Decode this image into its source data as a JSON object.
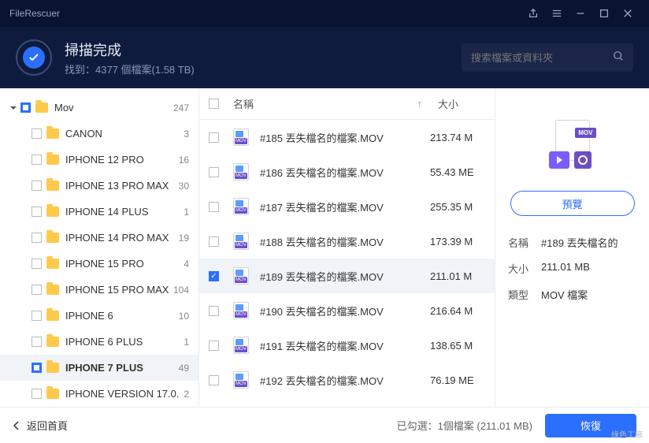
{
  "app_title": "FileRescuer",
  "header": {
    "title": "掃描完成",
    "subtitle": "找到：4377 個檔案(1.58 TB)"
  },
  "search": {
    "placeholder": "搜索檔案或資料夾"
  },
  "sidebar": {
    "root": {
      "label": "Mov",
      "count": "247"
    },
    "items": [
      {
        "label": "CANON",
        "count": "3",
        "partial": false
      },
      {
        "label": "IPHONE 12 PRO",
        "count": "16",
        "partial": false
      },
      {
        "label": "IPHONE 13 PRO MAX",
        "count": "30",
        "partial": false
      },
      {
        "label": "IPHONE 14 PLUS",
        "count": "1",
        "partial": false
      },
      {
        "label": "IPHONE 14 PRO MAX",
        "count": "19",
        "partial": false
      },
      {
        "label": "IPHONE 15 PRO",
        "count": "4",
        "partial": false
      },
      {
        "label": "IPHONE 15 PRO MAX",
        "count": "104",
        "partial": false
      },
      {
        "label": "IPHONE 6",
        "count": "10",
        "partial": false
      },
      {
        "label": "IPHONE 6 PLUS",
        "count": "1",
        "partial": false
      },
      {
        "label": "IPHONE 7 PLUS",
        "count": "49",
        "partial": true,
        "selected": true
      },
      {
        "label": "IPHONE VERSION 17.0.",
        "count": "2",
        "partial": false
      }
    ]
  },
  "columns": {
    "name": "名稱",
    "size": "大小"
  },
  "files": [
    {
      "name": "#185 丟失檔名的檔案.MOV",
      "size": "213.74 M",
      "checked": false
    },
    {
      "name": "#186 丟失檔名的檔案.MOV",
      "size": "55.43 ME",
      "checked": false
    },
    {
      "name": "#187 丟失檔名的檔案.MOV",
      "size": "255.35 M",
      "checked": false
    },
    {
      "name": "#188 丟失檔名的檔案.MOV",
      "size": "173.39 M",
      "checked": false
    },
    {
      "name": "#189 丟失檔名的檔案.MOV",
      "size": "211.01 M",
      "checked": true,
      "selected": true
    },
    {
      "name": "#190 丟失檔名的檔案.MOV",
      "size": "216.64 M",
      "checked": false
    },
    {
      "name": "#191 丟失檔名的檔案.MOV",
      "size": "138.65 M",
      "checked": false
    },
    {
      "name": "#192 丟失檔名的檔案.MOV",
      "size": "76.19 ME",
      "checked": false
    }
  ],
  "preview": {
    "badge": "MOV",
    "button": "預覽",
    "name_label": "名稱",
    "name_value": "#189 丟失檔名的",
    "size_label": "大小",
    "size_value": "211.01 MB",
    "type_label": "類型",
    "type_value": "MOV 檔案"
  },
  "footer": {
    "back": "返回首頁",
    "selected": "已勾選：1個檔案 (211.01 MB)",
    "recover": "恢復"
  },
  "watermark": "綠色工廠"
}
